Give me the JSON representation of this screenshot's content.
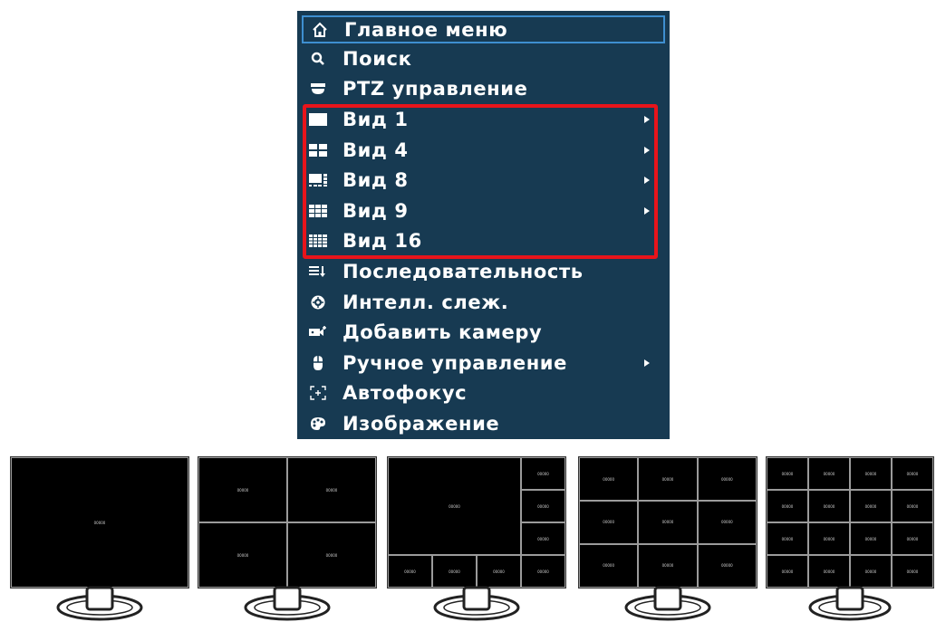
{
  "menu": {
    "items": [
      {
        "label": "Главное меню",
        "icon": "home-icon",
        "submenu": false,
        "selected": true
      },
      {
        "label": "Поиск",
        "icon": "search-icon",
        "submenu": false
      },
      {
        "label": "PTZ управление",
        "icon": "ptz-dome-icon",
        "submenu": false
      },
      {
        "label": "Вид 1",
        "icon": "layout-1-icon",
        "submenu": true
      },
      {
        "label": "Вид 4",
        "icon": "layout-4-icon",
        "submenu": true
      },
      {
        "label": "Вид 8",
        "icon": "layout-8-icon",
        "submenu": true
      },
      {
        "label": "Вид 9",
        "icon": "layout-9-icon",
        "submenu": true
      },
      {
        "label": "Вид 16",
        "icon": "layout-16-icon",
        "submenu": false
      },
      {
        "label": "Последовательность",
        "icon": "sequence-icon",
        "submenu": false
      },
      {
        "label": "Интелл. слеж.",
        "icon": "smart-track-icon",
        "submenu": false
      },
      {
        "label": "Добавить камеру",
        "icon": "add-camera-icon",
        "submenu": false
      },
      {
        "label": "Ручное управление",
        "icon": "manual-control-icon",
        "submenu": true
      },
      {
        "label": "Автофокус",
        "icon": "autofocus-icon",
        "submenu": false
      },
      {
        "label": "Изображение",
        "icon": "image-icon",
        "submenu": false
      }
    ],
    "highlight_color": "#e8141b",
    "background_color": "#173a52"
  },
  "monitors": [
    {
      "layout": "view-1",
      "pane_label": "00000"
    },
    {
      "layout": "view-4",
      "pane_label": "00000"
    },
    {
      "layout": "view-8",
      "pane_label": "00000"
    },
    {
      "layout": "view-9",
      "pane_label": "00000"
    },
    {
      "layout": "view-16",
      "pane_label": "00000"
    }
  ]
}
